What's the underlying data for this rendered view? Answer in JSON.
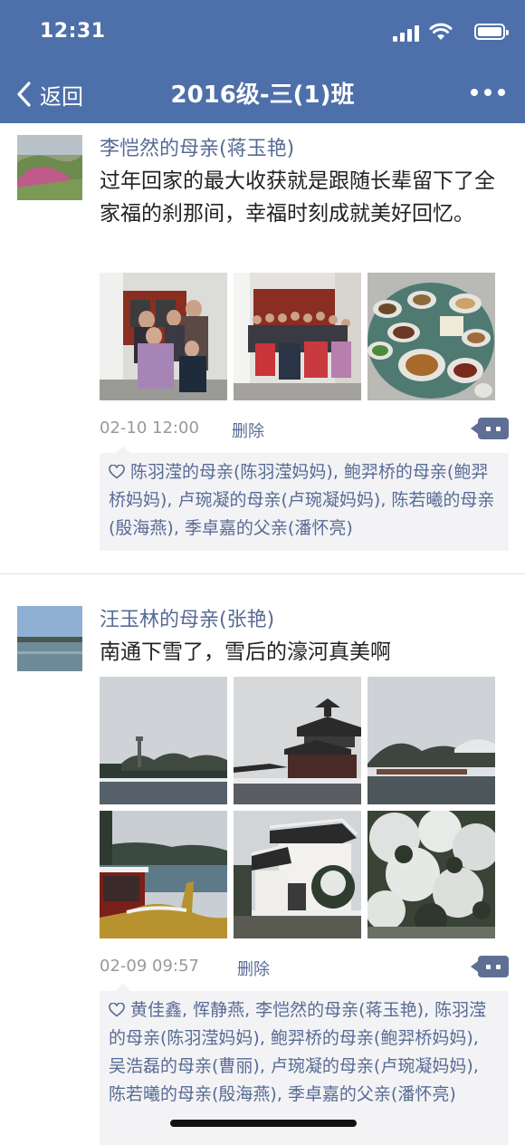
{
  "status_bar": {
    "time": "12:31"
  },
  "nav": {
    "back_label": "返回",
    "title": "2016级-三(1)班"
  },
  "posts": [
    {
      "author": "李恺然的母亲(蒋玉艳)",
      "text": "过年回家的最大收获就是跟随长辈留下了全家福的刹那间，幸福时刻成就美好回忆。",
      "time": "02-10 12:00",
      "delete_label": "删除",
      "likes": "陈羽滢的母亲(陈羽滢妈妈), 鲍羿桥的母亲(鲍羿桥妈妈), 卢琬凝的母亲(卢琬凝妈妈), 陈若曦的母亲(殷海燕), 季卓嘉的父亲(潘怀亮)"
    },
    {
      "author": "汪玉林的母亲(张艳)",
      "text": "南通下雪了，雪后的濠河真美啊",
      "time": "02-09 09:57",
      "delete_label": "删除",
      "likes": "黄佳鑫, 恽静燕, 李恺然的母亲(蒋玉艳), 陈羽滢的母亲(陈羽滢妈妈), 鲍羿桥的母亲(鲍羿桥妈妈), 吴浩磊的母亲(曹丽), 卢琬凝的母亲(卢琬凝妈妈), 陈若曦的母亲(殷海燕), 季卓嘉的父亲(潘怀亮)"
    }
  ],
  "icons": {
    "back": "chevron-left-icon",
    "more": "more-dots-icon",
    "comment": "comment-icon",
    "like": "heart-icon"
  },
  "colors": {
    "nav_background": "#4e70aa",
    "link": "#576b95",
    "likes_background": "#f3f3f5"
  }
}
